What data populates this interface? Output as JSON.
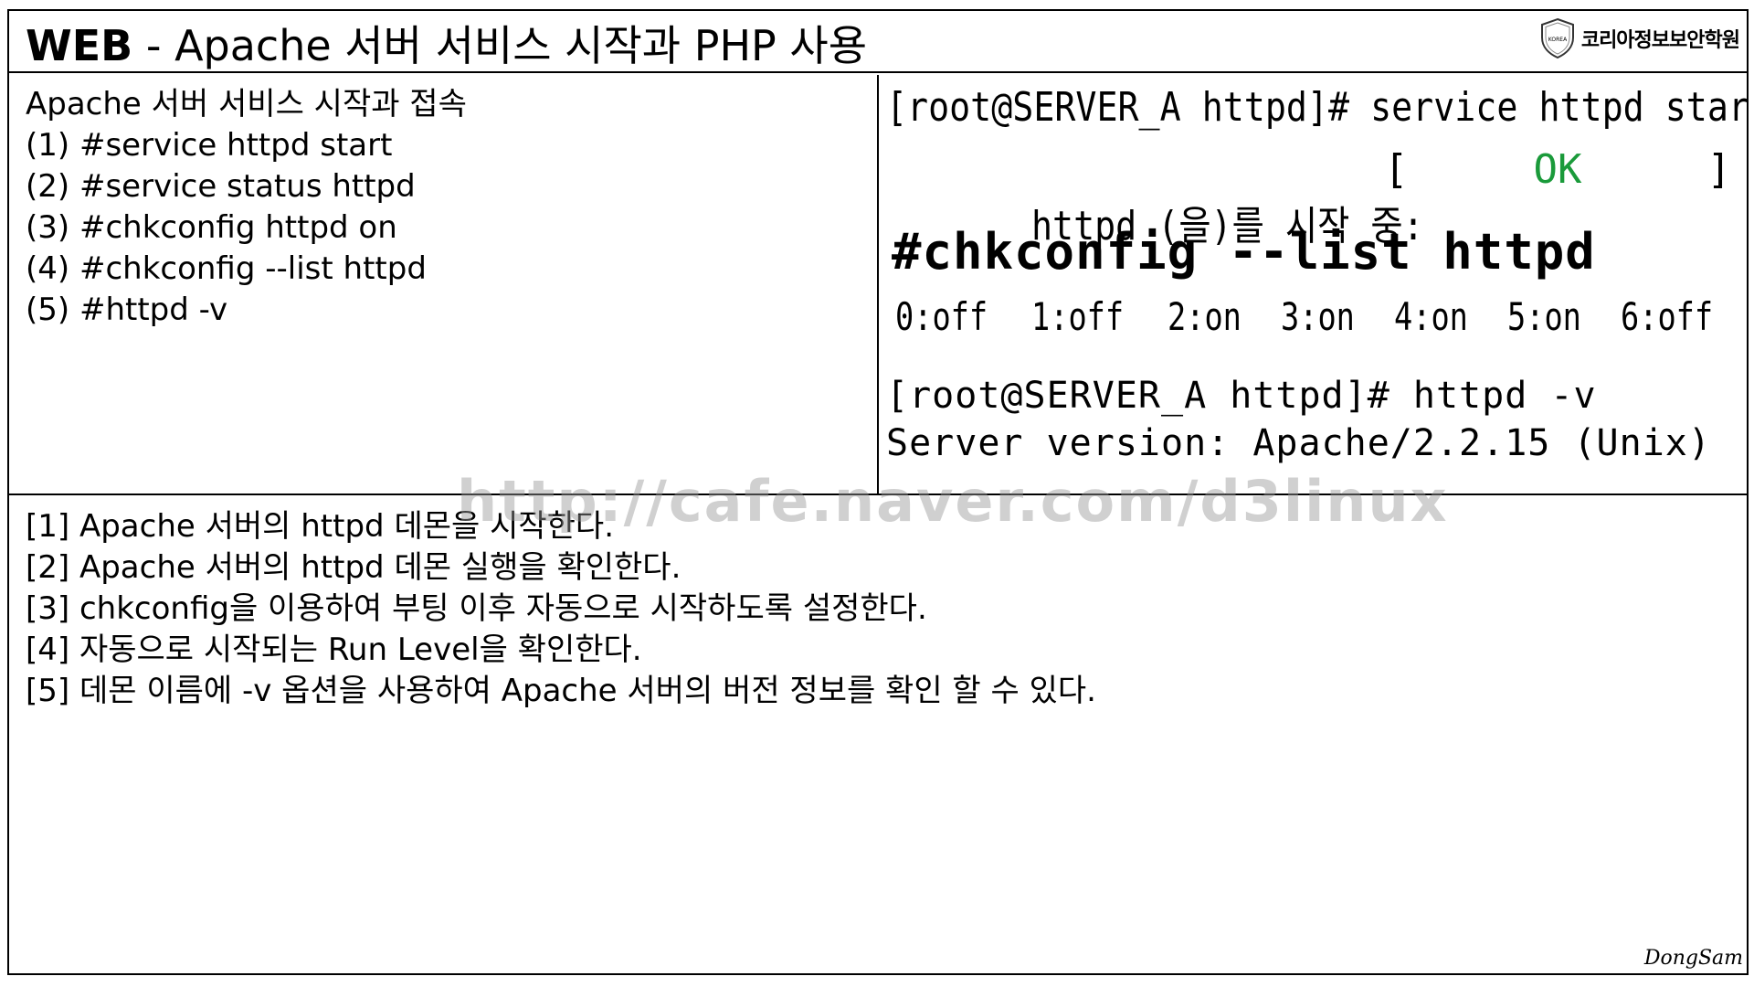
{
  "title": {
    "bold": "WEB",
    "rest": " - Apache 서버 서비스 시작과 PHP 사용"
  },
  "logo": {
    "badge": "KOREA",
    "text": "코리아정보보안학원"
  },
  "left": {
    "heading": "Apache 서버 서비스 시작과 접속",
    "steps": [
      "(1) #service httpd start",
      "(2) #service status httpd",
      "(3) #chkconfig httpd on",
      "(4) #chkconfig --list httpd",
      "(5) #httpd -v"
    ]
  },
  "terminal": {
    "line1": "[root@SERVER_A httpd]# service httpd start",
    "line2_label": "httpd (을)를 시작 중:",
    "bracket_open": "[",
    "ok": "OK",
    "bracket_close": "]",
    "line3": "#chkconfig --list httpd",
    "runlevels": [
      "0:off",
      "1:off",
      "2:on",
      "3:on",
      "4:on",
      "5:on",
      "6:off"
    ],
    "line4": "[root@SERVER_A httpd]# httpd -v",
    "line5": "Server version: Apache/2.2.15 (Unix)",
    "ok_color": "#1a9a3a"
  },
  "notes": [
    "[1] Apache 서버의 httpd 데몬을 시작한다.",
    "[2] Apache 서버의 httpd 데몬 실행을 확인한다.",
    "[3] chkconfig을 이용하여 부팅 이후 자동으로 시작하도록 설정한다.",
    "[4] 자동으로 시작되는 Run Level을 확인한다.",
    "[5] 데몬 이름에 -v 옵션을 사용하여 Apache 서버의 버전 정보를 확인 할 수 있다."
  ],
  "watermark": "http://cafe.naver.com/d3linux",
  "signature": "DongSam"
}
